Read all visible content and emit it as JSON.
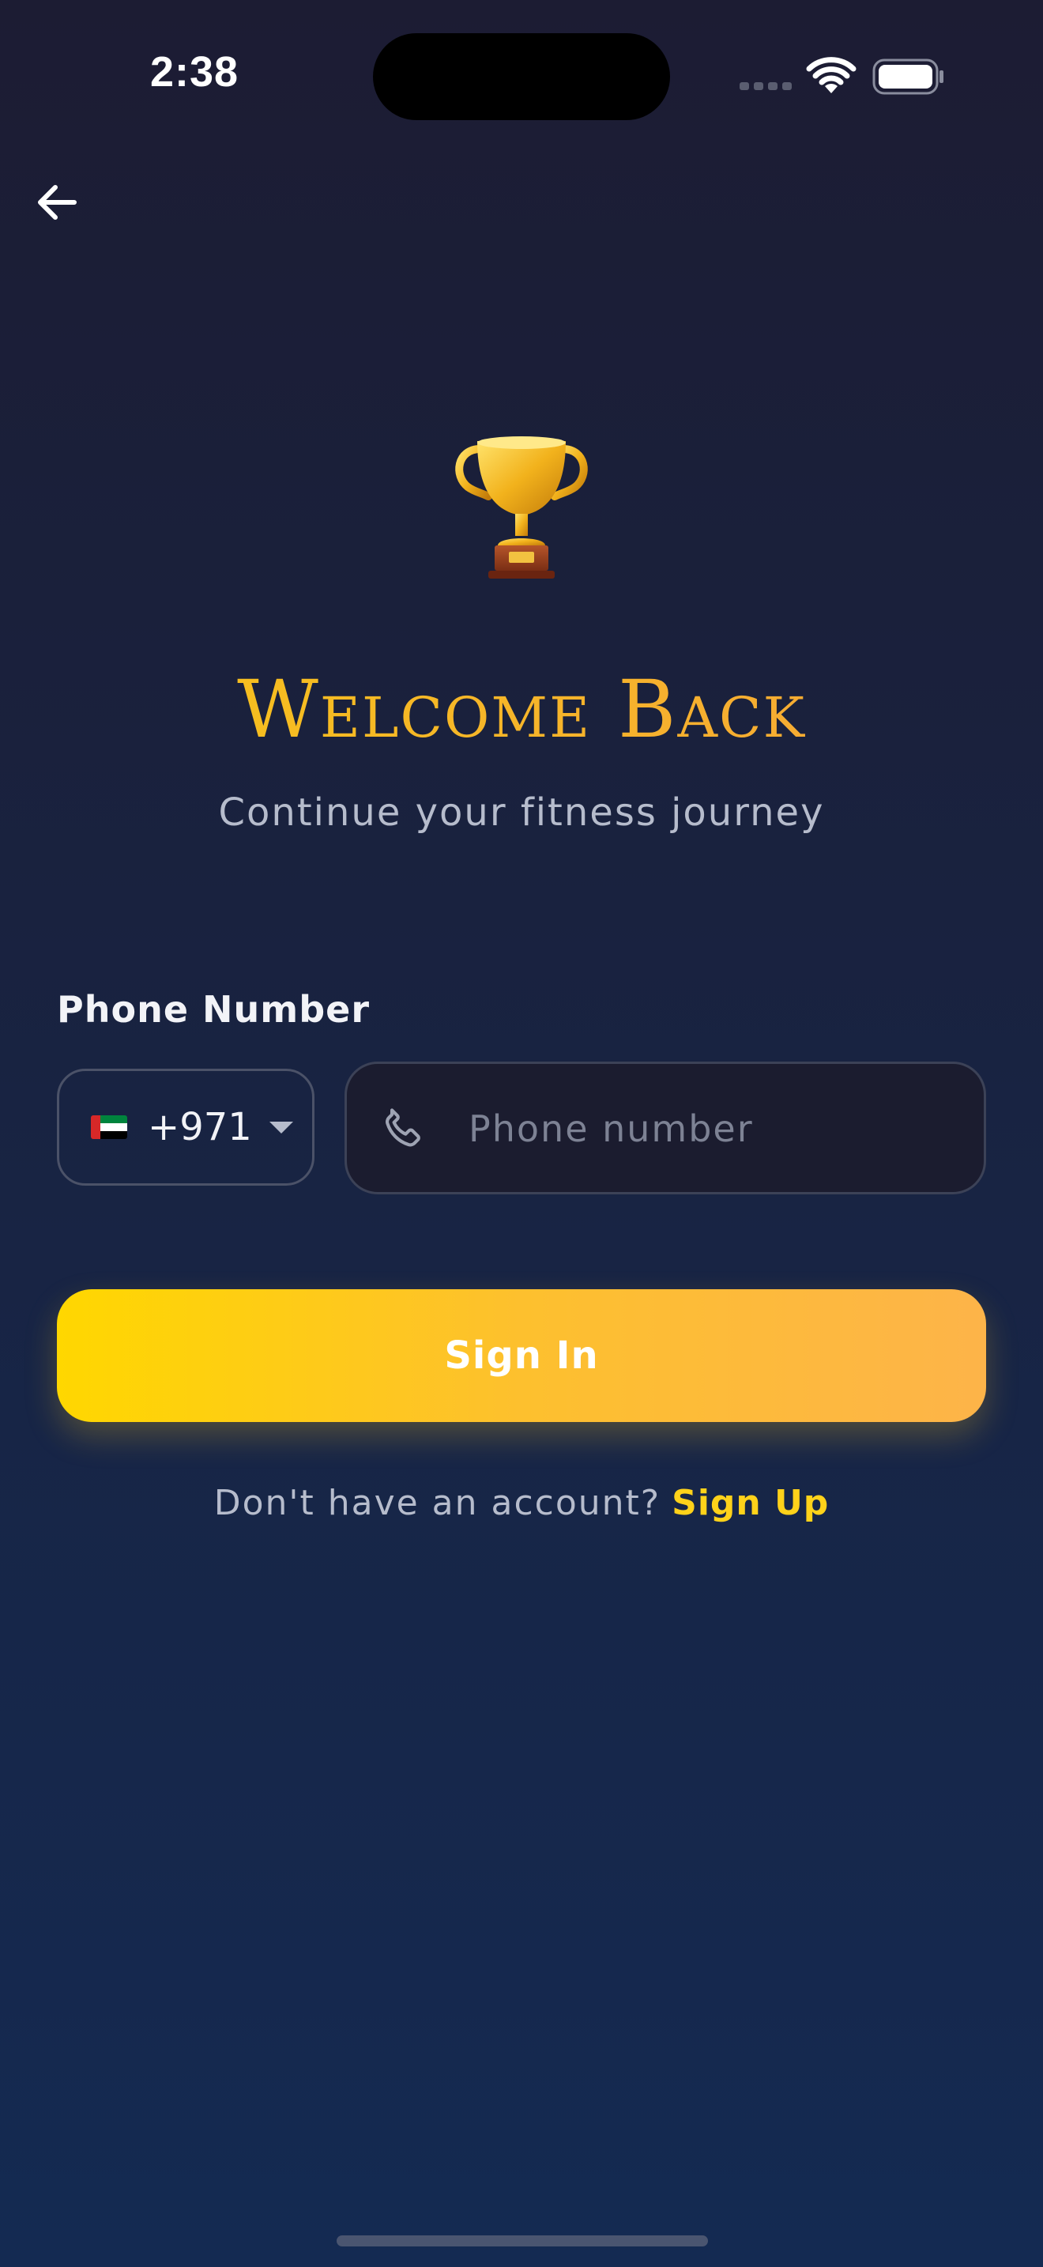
{
  "status_bar": {
    "time": "2:38",
    "icons": [
      "signal-icon",
      "wifi-icon",
      "battery-icon"
    ]
  },
  "nav": {
    "back_icon": "arrow-left-icon"
  },
  "hero": {
    "icon": "trophy-icon",
    "title": "Welcome Back",
    "subtitle": "Continue your fitness journey"
  },
  "form": {
    "phone_label": "Phone Number",
    "country": {
      "flag": "uae-flag-icon",
      "code": "+971"
    },
    "phone_input": {
      "value": "",
      "placeholder": "Phone number",
      "icon": "phone-icon"
    },
    "submit_label": "Sign In"
  },
  "footer": {
    "prompt": "Don't have an account?",
    "link_label": "Sign Up"
  },
  "colors": {
    "accent_gold": "#ffd21a",
    "button_gradient_start": "#ffd700",
    "button_gradient_end": "#fdb449",
    "background_top": "#1c1c33",
    "background_bottom": "#142a52"
  }
}
